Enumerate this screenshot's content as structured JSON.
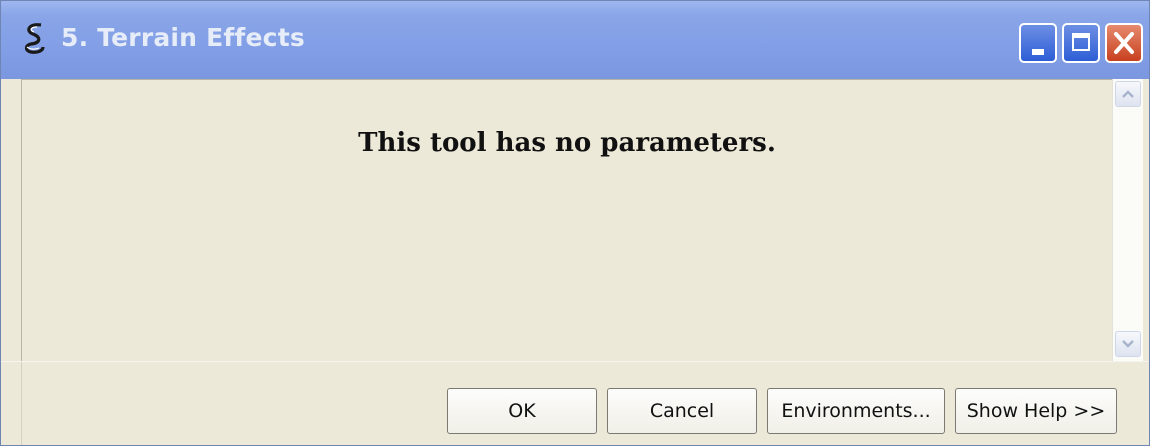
{
  "window": {
    "title": "5. Terrain Effects",
    "app_icon": "toolbox-script-icon",
    "controls": {
      "minimize_icon": "minimize-icon",
      "maximize_icon": "maximize-icon",
      "close_icon": "close-icon"
    }
  },
  "content": {
    "message": "This tool has no parameters."
  },
  "scrollbar": {
    "up_icon": "scroll-up-arrow-icon",
    "down_icon": "scroll-down-arrow-icon"
  },
  "footer": {
    "ok_label": "OK",
    "cancel_label": "Cancel",
    "environments_label": "Environments...",
    "show_help_label": "Show Help >>"
  },
  "colors": {
    "titlebar": "#839fe6",
    "title_text": "#e6ecf8",
    "dialog_background": "#ece9d8",
    "close_button": "#c8401f"
  }
}
